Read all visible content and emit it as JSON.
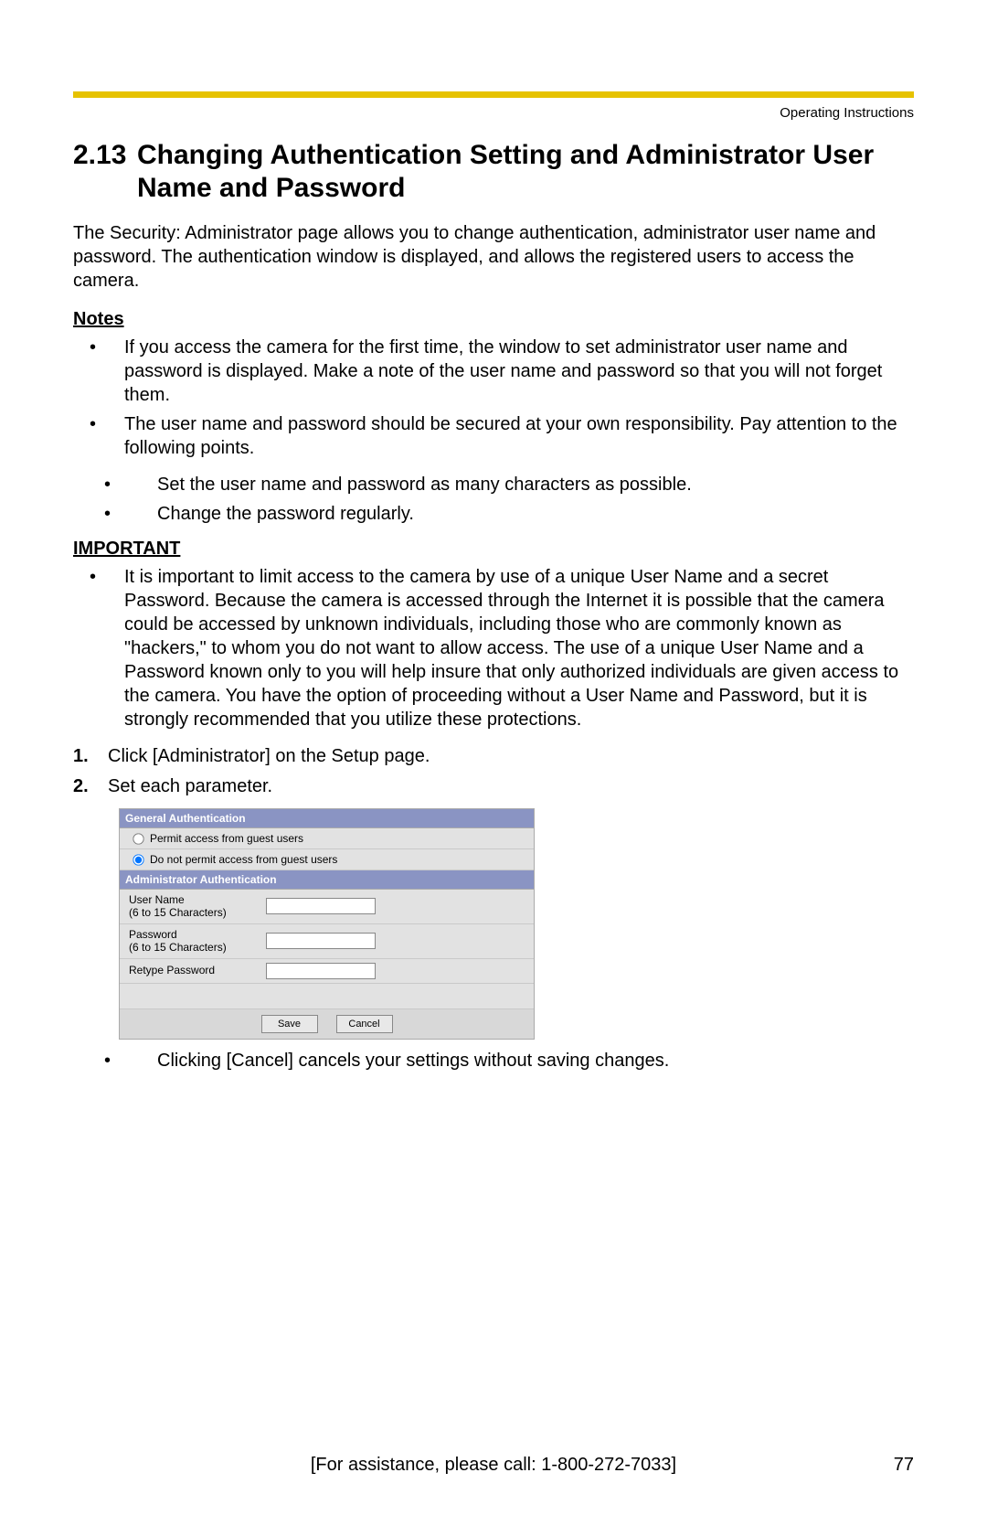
{
  "header": {
    "label": "Operating Instructions"
  },
  "section": {
    "number": "2.13",
    "title": "Changing Authentication Setting and Administrator User Name and Password"
  },
  "intro": "The Security: Administrator page allows you to change authentication, administrator user name and password. The authentication window is displayed, and allows the registered users to access the camera.",
  "notes": {
    "label": "Notes",
    "items": [
      "If you access the camera for the first time, the window to set administrator user name and password is displayed. Make a note of the user name and password so that you will not forget them.",
      "The user name and password should be secured at your own responsibility. Pay attention to the following points."
    ],
    "sub": [
      "Set the user name and password as many characters as possible.",
      "Change the password regularly."
    ]
  },
  "important": {
    "label": "IMPORTANT",
    "text": "It is important to limit access to the camera by use of a unique User Name and a secret Password. Because the camera is accessed through the Internet it is possible that the camera could be accessed by unknown individuals, including those who are commonly known as \"hackers,\" to whom you do not want to allow access. The use of a unique User Name and a Password known only to you will help insure that only authorized individuals are given access to the camera. You have the option of proceeding without a User Name and Password, but it is strongly recommended that you utilize these protections."
  },
  "steps": [
    {
      "num": "1.",
      "text": "Click [Administrator] on the Setup page."
    },
    {
      "num": "2.",
      "text": "Set each parameter."
    }
  ],
  "panel": {
    "header1": "General Authentication",
    "radio1": "Permit access from guest users",
    "radio2": "Do not permit access from guest users",
    "header2": "Administrator Authentication",
    "user_label1": "User Name",
    "user_label2": "(6 to 15 Characters)",
    "pass_label1": "Password",
    "pass_label2": "(6 to 15 Characters)",
    "retype_label": "Retype Password",
    "save": "Save",
    "cancel": "Cancel"
  },
  "after_figure": "Clicking [Cancel] cancels your settings without saving changes.",
  "footer": "[For assistance, please call: 1-800-272-7033]",
  "page_num": "77"
}
